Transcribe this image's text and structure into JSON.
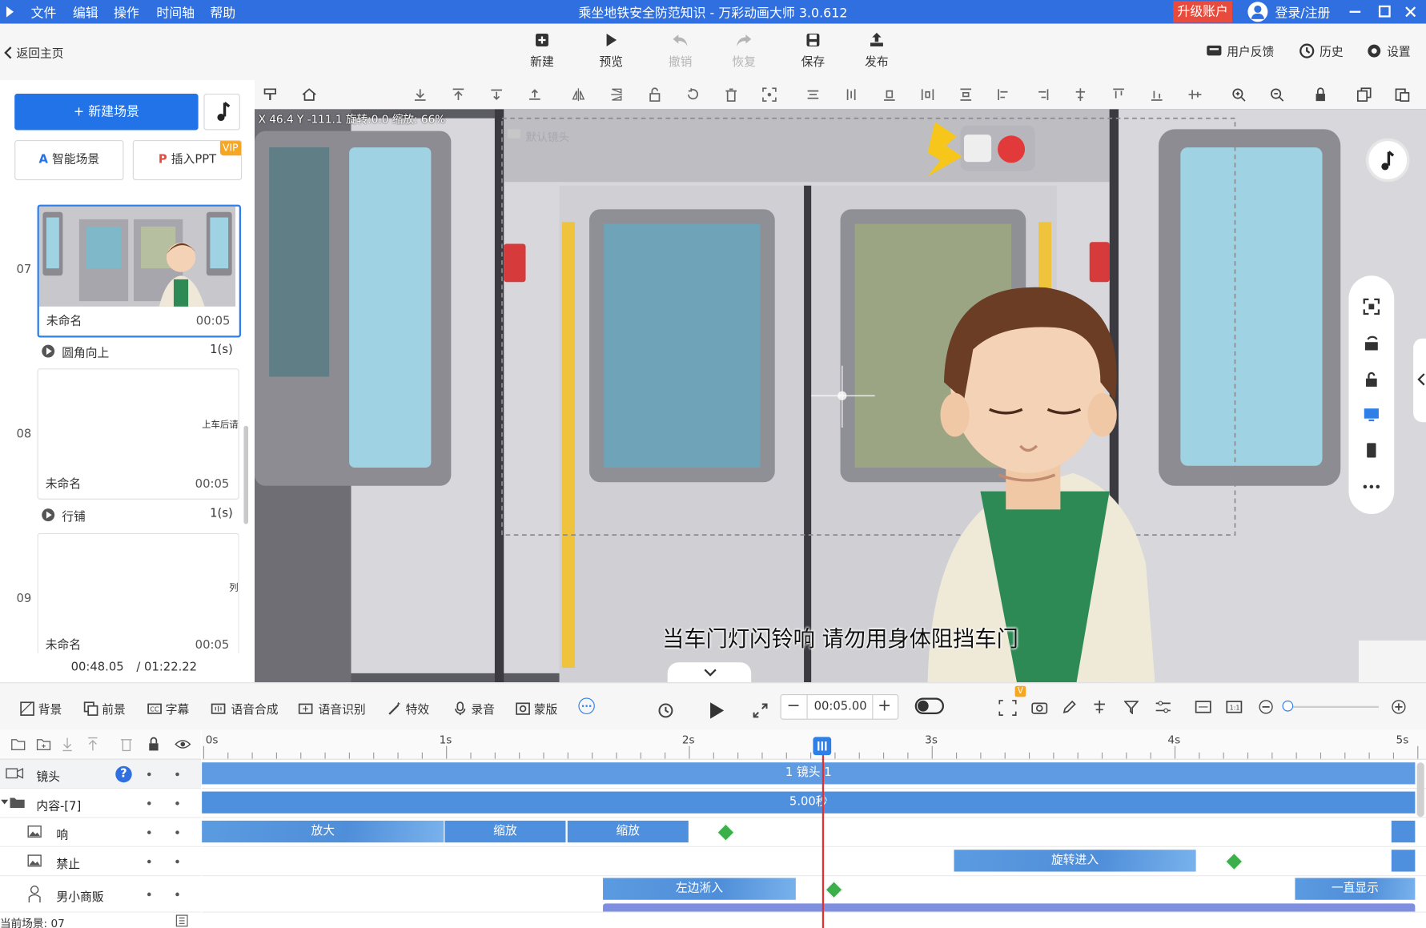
{
  "app": {
    "window_title": "乘坐地铁安全防范知识 - 万彩动画大师 3.0.612",
    "menu": [
      "文件",
      "编辑",
      "操作",
      "时间轴",
      "帮助"
    ],
    "upgrade_label": "升级账户",
    "login_label": "登录/注册"
  },
  "toolbar": {
    "back_label": "返回主页",
    "new_label": "新建",
    "preview_label": "预览",
    "undo_label": "撤销",
    "redo_label": "恢复",
    "save_label": "保存",
    "publish_label": "发布",
    "feedback_label": "用户反馈",
    "history_label": "历史",
    "settings_label": "设置"
  },
  "scene_panel": {
    "new_scene_label": "新建场景",
    "smart_scene_label": "智能场景",
    "insert_ppt_label": "插入PPT",
    "vip_badge": "VIP",
    "scenes": [
      {
        "number": "07",
        "name": "未命名",
        "duration": "00:05",
        "transition": "圆角向上",
        "transition_duration": "1(s)",
        "thumb_text": ""
      },
      {
        "number": "08",
        "name": "未命名",
        "duration": "00:05",
        "transition": "行铺",
        "transition_duration": "1(s)",
        "thumb_text": "上车后请"
      },
      {
        "number": "09",
        "name": "未命名",
        "duration": "00:05",
        "transition": "",
        "transition_duration": "",
        "thumb_text": "列"
      }
    ],
    "current_time": "00:48.05",
    "total_time": "/ 01:22.22"
  },
  "canvas": {
    "coords_readout": "X 46.4 Y -111.1 旋转:0.0 缩放: 66%",
    "camera_label": "默认镜头",
    "subtitle": "当车门灯闪铃响 请勿用身体阻挡车门"
  },
  "media_bar": {
    "items": [
      "背景",
      "前景",
      "字幕",
      "语音合成",
      "语音识别",
      "特效",
      "录音",
      "蒙版"
    ],
    "time_value": "00:05.00"
  },
  "timeline": {
    "ruler_labels": [
      "0s",
      "1s",
      "2s",
      "3s",
      "4s",
      "5s"
    ],
    "tracks": [
      {
        "name": "镜头",
        "clips": [
          {
            "label": "1 镜头 1"
          }
        ]
      },
      {
        "name": "内容-[7]",
        "clips": [
          {
            "label": "5.00秒"
          }
        ]
      },
      {
        "name": "响",
        "clips": [
          {
            "label": "放大"
          },
          {
            "label": "缩放"
          },
          {
            "label": "缩放"
          }
        ]
      },
      {
        "name": "禁止",
        "clips": [
          {
            "label": "旋转进入"
          }
        ]
      },
      {
        "name": "男小商贩",
        "clips": [
          {
            "label": "左边淅入"
          },
          {
            "label": "一直显示"
          }
        ]
      }
    ],
    "current_scene_label": "当前场景: 07"
  },
  "colors": {
    "title_bar": "#2f6fe0",
    "primary_button": "#2272e8",
    "clip": "#4f90de",
    "keyframe": "#3bb04a",
    "playhead": "#e03030",
    "upgrade": "#e84a3c"
  }
}
